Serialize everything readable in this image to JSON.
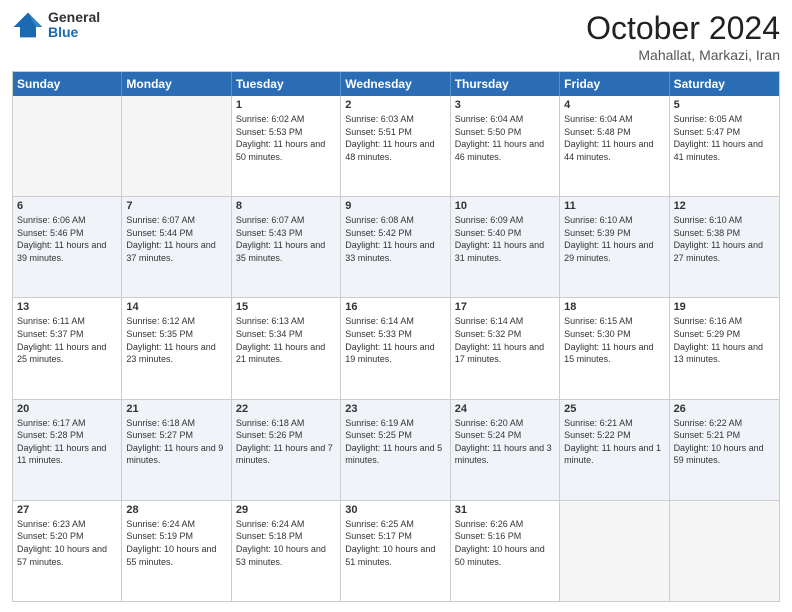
{
  "header": {
    "logo_general": "General",
    "logo_blue": "Blue",
    "month_title": "October 2024",
    "subtitle": "Mahallat, Markazi, Iran"
  },
  "days_of_week": [
    "Sunday",
    "Monday",
    "Tuesday",
    "Wednesday",
    "Thursday",
    "Friday",
    "Saturday"
  ],
  "weeks": [
    [
      {
        "day": "",
        "info": ""
      },
      {
        "day": "",
        "info": ""
      },
      {
        "day": "1",
        "info": "Sunrise: 6:02 AM\nSunset: 5:53 PM\nDaylight: 11 hours and 50 minutes."
      },
      {
        "day": "2",
        "info": "Sunrise: 6:03 AM\nSunset: 5:51 PM\nDaylight: 11 hours and 48 minutes."
      },
      {
        "day": "3",
        "info": "Sunrise: 6:04 AM\nSunset: 5:50 PM\nDaylight: 11 hours and 46 minutes."
      },
      {
        "day": "4",
        "info": "Sunrise: 6:04 AM\nSunset: 5:48 PM\nDaylight: 11 hours and 44 minutes."
      },
      {
        "day": "5",
        "info": "Sunrise: 6:05 AM\nSunset: 5:47 PM\nDaylight: 11 hours and 41 minutes."
      }
    ],
    [
      {
        "day": "6",
        "info": "Sunrise: 6:06 AM\nSunset: 5:46 PM\nDaylight: 11 hours and 39 minutes."
      },
      {
        "day": "7",
        "info": "Sunrise: 6:07 AM\nSunset: 5:44 PM\nDaylight: 11 hours and 37 minutes."
      },
      {
        "day": "8",
        "info": "Sunrise: 6:07 AM\nSunset: 5:43 PM\nDaylight: 11 hours and 35 minutes."
      },
      {
        "day": "9",
        "info": "Sunrise: 6:08 AM\nSunset: 5:42 PM\nDaylight: 11 hours and 33 minutes."
      },
      {
        "day": "10",
        "info": "Sunrise: 6:09 AM\nSunset: 5:40 PM\nDaylight: 11 hours and 31 minutes."
      },
      {
        "day": "11",
        "info": "Sunrise: 6:10 AM\nSunset: 5:39 PM\nDaylight: 11 hours and 29 minutes."
      },
      {
        "day": "12",
        "info": "Sunrise: 6:10 AM\nSunset: 5:38 PM\nDaylight: 11 hours and 27 minutes."
      }
    ],
    [
      {
        "day": "13",
        "info": "Sunrise: 6:11 AM\nSunset: 5:37 PM\nDaylight: 11 hours and 25 minutes."
      },
      {
        "day": "14",
        "info": "Sunrise: 6:12 AM\nSunset: 5:35 PM\nDaylight: 11 hours and 23 minutes."
      },
      {
        "day": "15",
        "info": "Sunrise: 6:13 AM\nSunset: 5:34 PM\nDaylight: 11 hours and 21 minutes."
      },
      {
        "day": "16",
        "info": "Sunrise: 6:14 AM\nSunset: 5:33 PM\nDaylight: 11 hours and 19 minutes."
      },
      {
        "day": "17",
        "info": "Sunrise: 6:14 AM\nSunset: 5:32 PM\nDaylight: 11 hours and 17 minutes."
      },
      {
        "day": "18",
        "info": "Sunrise: 6:15 AM\nSunset: 5:30 PM\nDaylight: 11 hours and 15 minutes."
      },
      {
        "day": "19",
        "info": "Sunrise: 6:16 AM\nSunset: 5:29 PM\nDaylight: 11 hours and 13 minutes."
      }
    ],
    [
      {
        "day": "20",
        "info": "Sunrise: 6:17 AM\nSunset: 5:28 PM\nDaylight: 11 hours and 11 minutes."
      },
      {
        "day": "21",
        "info": "Sunrise: 6:18 AM\nSunset: 5:27 PM\nDaylight: 11 hours and 9 minutes."
      },
      {
        "day": "22",
        "info": "Sunrise: 6:18 AM\nSunset: 5:26 PM\nDaylight: 11 hours and 7 minutes."
      },
      {
        "day": "23",
        "info": "Sunrise: 6:19 AM\nSunset: 5:25 PM\nDaylight: 11 hours and 5 minutes."
      },
      {
        "day": "24",
        "info": "Sunrise: 6:20 AM\nSunset: 5:24 PM\nDaylight: 11 hours and 3 minutes."
      },
      {
        "day": "25",
        "info": "Sunrise: 6:21 AM\nSunset: 5:22 PM\nDaylight: 11 hours and 1 minute."
      },
      {
        "day": "26",
        "info": "Sunrise: 6:22 AM\nSunset: 5:21 PM\nDaylight: 10 hours and 59 minutes."
      }
    ],
    [
      {
        "day": "27",
        "info": "Sunrise: 6:23 AM\nSunset: 5:20 PM\nDaylight: 10 hours and 57 minutes."
      },
      {
        "day": "28",
        "info": "Sunrise: 6:24 AM\nSunset: 5:19 PM\nDaylight: 10 hours and 55 minutes."
      },
      {
        "day": "29",
        "info": "Sunrise: 6:24 AM\nSunset: 5:18 PM\nDaylight: 10 hours and 53 minutes."
      },
      {
        "day": "30",
        "info": "Sunrise: 6:25 AM\nSunset: 5:17 PM\nDaylight: 10 hours and 51 minutes."
      },
      {
        "day": "31",
        "info": "Sunrise: 6:26 AM\nSunset: 5:16 PM\nDaylight: 10 hours and 50 minutes."
      },
      {
        "day": "",
        "info": ""
      },
      {
        "day": "",
        "info": ""
      }
    ]
  ]
}
